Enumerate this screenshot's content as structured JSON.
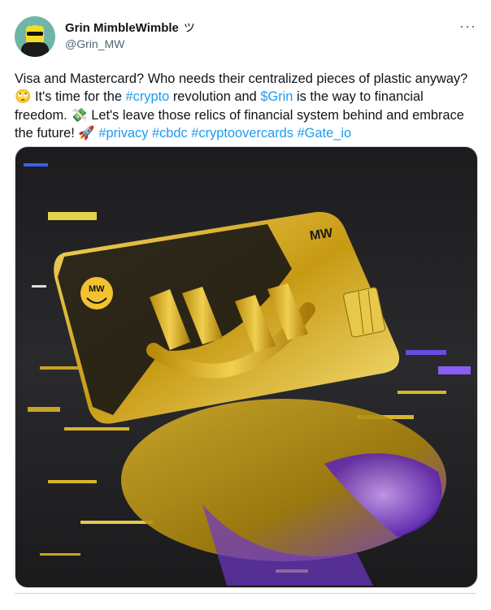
{
  "author": {
    "name": "Grin MimbleWimble",
    "name_suffix": "ツ",
    "handle": "@Grin_MW",
    "avatar_icon": "avatar-character-icon"
  },
  "more_glyph": "···",
  "tweet": {
    "segments": [
      {
        "t": "Visa and Mastercard? Who needs their centralized pieces of plastic anyway? ",
        "tag": false
      },
      {
        "t": "🙄",
        "tag": false
      },
      {
        "t": " It's time for the ",
        "tag": false
      },
      {
        "t": "#crypto",
        "tag": true
      },
      {
        "t": " revolution and ",
        "tag": false
      },
      {
        "t": "$Grin",
        "tag": true
      },
      {
        "t": " is the way to financial freedom. ",
        "tag": false
      },
      {
        "t": "💸",
        "tag": false
      },
      {
        "t": " Let's leave those relics of financial system behind and embrace the future! ",
        "tag": false
      },
      {
        "t": "🚀",
        "tag": false
      },
      {
        "t": " ",
        "tag": false
      },
      {
        "t": "#privacy",
        "tag": true
      },
      {
        "t": " ",
        "tag": false
      },
      {
        "t": "#cbdc",
        "tag": true
      },
      {
        "t": " ",
        "tag": false
      },
      {
        "t": "#cryptoovercards",
        "tag": true
      },
      {
        "t": " ",
        "tag": false
      },
      {
        "t": "#Gate_io",
        "tag": true
      }
    ]
  },
  "media": {
    "card_brand": "MW",
    "logo_text": "MW",
    "colors": {
      "gold": "#d9b52a",
      "dark": "#1c1c1e",
      "glitch_blue": "#3b5bff",
      "glitch_purple": "#9b4dff"
    }
  },
  "colors": {
    "link": "#1d9bf0",
    "secondary": "#536471",
    "text": "#0f1419"
  }
}
